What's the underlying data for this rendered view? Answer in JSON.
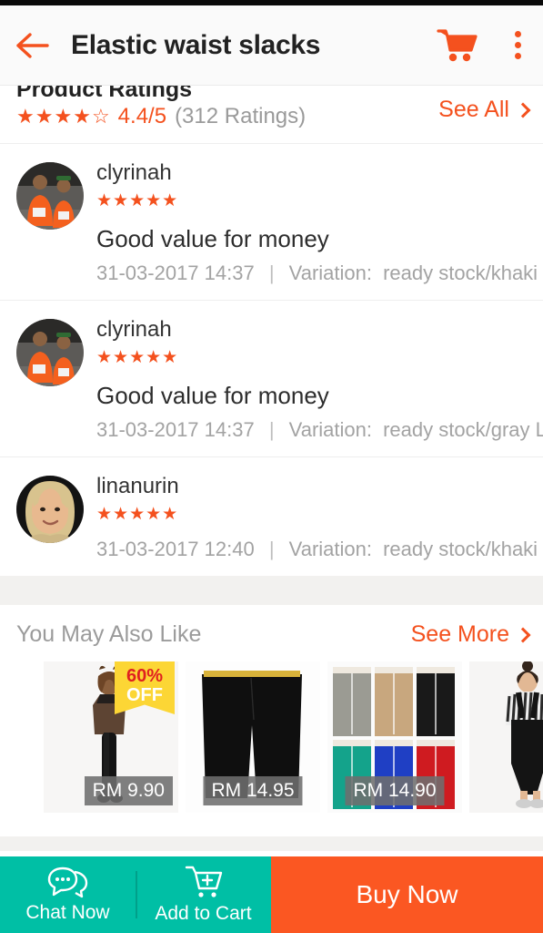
{
  "header": {
    "title": "Elastic waist slacks",
    "back_icon": "arrow-left-icon",
    "cart_icon": "shopping-cart-icon",
    "menu_icon": "overflow-menu-icon",
    "accent_color": "#f4511e"
  },
  "ratings": {
    "title": "Product Ratings",
    "stars_filled": 4,
    "stars_total": 5,
    "score": "4.4/5",
    "count": "(312 Ratings)",
    "see_all_label": "See All"
  },
  "reviews": [
    {
      "username": "clyrinah",
      "stars": 5,
      "comment": "Good value for money",
      "date": "31-03-2017 14:37",
      "separator": "|",
      "variation_label": "Variation:",
      "variation_value": "ready stock/khaki XL",
      "avatar": "avatar-two-people-orange-shirts"
    },
    {
      "username": "clyrinah",
      "stars": 5,
      "comment": "Good value for money",
      "date": "31-03-2017 14:37",
      "separator": "|",
      "variation_label": "Variation:",
      "variation_value": "ready stock/gray L",
      "avatar": "avatar-two-people-orange-shirts"
    },
    {
      "username": "linanurin",
      "stars": 5,
      "comment": "",
      "date": "31-03-2017 12:40",
      "separator": "|",
      "variation_label": "Variation:",
      "variation_value": "ready stock/khaki XL",
      "avatar": "avatar-woman-hijab"
    }
  ],
  "you_may_also_like": {
    "title": "You May Also Like",
    "see_more_label": "See More",
    "products": [
      {
        "price": "RM 9.90",
        "discount_pct": "60%",
        "discount_off": "OFF",
        "image": "product-woman-brown-top-black-leggings"
      },
      {
        "price": "RM 14.95",
        "image": "product-black-wide-leg-pants"
      },
      {
        "price": "RM 14.90",
        "image": "product-pants-color-grid"
      },
      {
        "price": "",
        "image": "product-woman-black-overalls"
      }
    ]
  },
  "bottom_bar": {
    "chat_label": "Chat Now",
    "chat_icon": "chat-bubbles-icon",
    "cart_label": "Add to Cart",
    "cart_icon": "cart-plus-icon",
    "buy_label": "Buy Now",
    "teal_color": "#00bfa5",
    "orange_color": "#fb5722"
  }
}
